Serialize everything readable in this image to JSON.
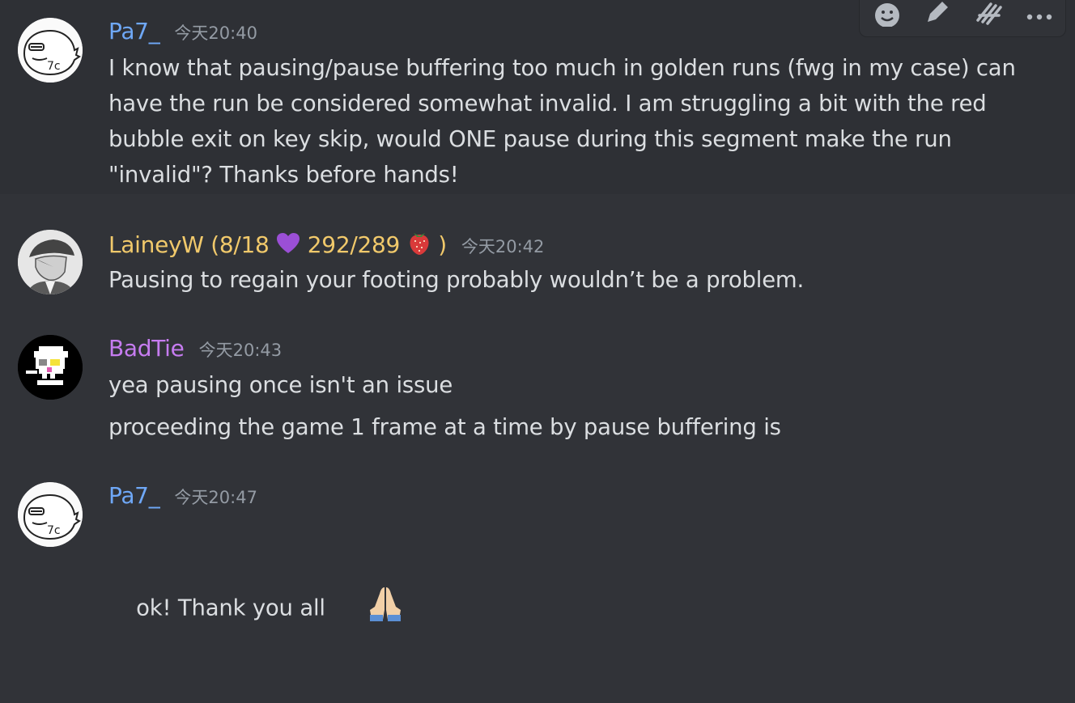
{
  "messages": [
    {
      "author": "Pa7_",
      "author_color": "#6fa8f7",
      "timestamp": "今天20:40",
      "lines": [
        "I know that pausing/pause buffering too much in golden runs (fwg in my case) can",
        "have the run be considered somewhat invalid. I am struggling a bit with the red",
        "bubble exit on key skip, would ONE pause during this segment make the run",
        "\"invalid\"? Thanks before hands!"
      ]
    },
    {
      "author_prefix": "LaineyW (8/18",
      "author_mid": "292/289",
      "author_suffix": ")",
      "author_color": "#f1c96b",
      "timestamp": "今天20:42",
      "lines": [
        "Pausing to regain your footing probably wouldn’t be a problem."
      ]
    },
    {
      "author": "BadTie",
      "author_color": "#c67cf0",
      "timestamp": "今天20:43",
      "lines": [
        "yea pausing once isn't an issue",
        "proceeding the game 1 frame at a time by pause buffering is"
      ]
    },
    {
      "author": "Pa7_",
      "author_color": "#6fa8f7",
      "timestamp": "今天20:47",
      "lines": [
        "ok! Thank you all"
      ]
    }
  ],
  "toolbar": {
    "icons": [
      "add-reaction-icon",
      "edit-icon",
      "thread-icon",
      "more-icon"
    ]
  },
  "emoji": [
    "purple-heart",
    "strawberry",
    "folded-hands"
  ]
}
